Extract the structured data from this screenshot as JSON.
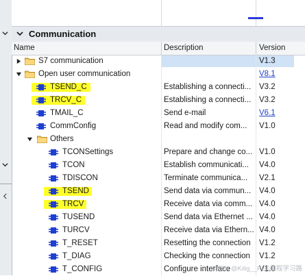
{
  "panel": {
    "section_title": "Communication"
  },
  "columns": {
    "name": "Name",
    "description": "Description",
    "version": "Version"
  },
  "rows": [
    {
      "label": "S7 communication",
      "desc": "",
      "ver": "V1.3",
      "type": "folder",
      "level": 0,
      "state": "collapsed",
      "selected": true,
      "link": false,
      "highlight": false
    },
    {
      "label": "Open user communication",
      "desc": "",
      "ver": "V8.1",
      "type": "folder",
      "level": 0,
      "state": "expanded",
      "selected": false,
      "link": true,
      "highlight": false
    },
    {
      "label": "TSEND_C",
      "desc": "Establishing a connecti...",
      "ver": "V3.2",
      "type": "block",
      "level": 1,
      "selected": false,
      "link": false,
      "highlight": true
    },
    {
      "label": "TRCV_C",
      "desc": "Establishing a connecti...",
      "ver": "V3.2",
      "type": "block",
      "level": 1,
      "selected": false,
      "link": false,
      "highlight": true
    },
    {
      "label": "TMAIL_C",
      "desc": "Send e-mail",
      "ver": "V6.1",
      "type": "block",
      "level": 1,
      "selected": false,
      "link": true,
      "highlight": false
    },
    {
      "label": "CommConfig",
      "desc": "Read and modify com...",
      "ver": "V1.0",
      "type": "block",
      "level": 1,
      "selected": false,
      "link": false,
      "highlight": false
    },
    {
      "label": "Others",
      "desc": "",
      "ver": "",
      "type": "folder",
      "level": 1,
      "state": "expanded",
      "selected": false,
      "link": false,
      "highlight": false
    },
    {
      "label": "TCONSettings",
      "desc": "Prepare and change co...",
      "ver": "V1.0",
      "type": "block",
      "level": 2,
      "selected": false,
      "link": false,
      "highlight": false
    },
    {
      "label": "TCON",
      "desc": "Establish communicati...",
      "ver": "V4.0",
      "type": "block",
      "level": 2,
      "selected": false,
      "link": false,
      "highlight": false
    },
    {
      "label": "TDISCON",
      "desc": "Terminate communica...",
      "ver": "V2.1",
      "type": "block",
      "level": 2,
      "selected": false,
      "link": false,
      "highlight": false
    },
    {
      "label": "TSEND",
      "desc": "Send data via commun...",
      "ver": "V4.0",
      "type": "block",
      "level": 2,
      "selected": false,
      "link": false,
      "highlight": true
    },
    {
      "label": "TRCV",
      "desc": "Receive data via comm...",
      "ver": "V4.0",
      "type": "block",
      "level": 2,
      "selected": false,
      "link": false,
      "highlight": true
    },
    {
      "label": "TUSEND",
      "desc": "Send data via Ethernet ...",
      "ver": "V4.0",
      "type": "block",
      "level": 2,
      "selected": false,
      "link": false,
      "highlight": false
    },
    {
      "label": "TURCV",
      "desc": "Receive data via Ethern...",
      "ver": "V4.0",
      "type": "block",
      "level": 2,
      "selected": false,
      "link": false,
      "highlight": false
    },
    {
      "label": "T_RESET",
      "desc": "Resetting the connection",
      "ver": "V1.2",
      "type": "block",
      "level": 2,
      "selected": false,
      "link": false,
      "highlight": false
    },
    {
      "label": "T_DIAG",
      "desc": "Checking the connection",
      "ver": "V1.2",
      "type": "block",
      "level": 2,
      "selected": false,
      "link": false,
      "highlight": false
    },
    {
      "label": "T_CONFIG",
      "desc": "Configure interface",
      "ver": "V1.0",
      "type": "block",
      "level": 2,
      "selected": false,
      "link": false,
      "highlight": false
    }
  ],
  "watermark": "CSDN @Kilig__PLC编程学习路",
  "colors": {
    "selection": "#cfe2f6",
    "highlight": "#ffff2a",
    "block_icon": "#1f3fd0",
    "folder": "#f5c45a",
    "link": "#1f3fc8"
  },
  "icons": {
    "section_toggle": "chevron-down-icon",
    "collapsed": "triangle-right-icon",
    "expanded": "triangle-down-icon",
    "folder": "folder-icon",
    "block": "function-block-icon"
  }
}
